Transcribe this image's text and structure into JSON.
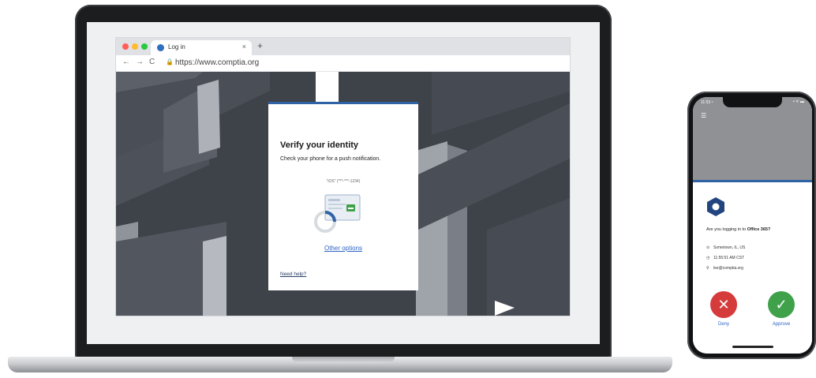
{
  "browser": {
    "tab_title": "Log in",
    "tab_close": "×",
    "new_tab": "+",
    "back": "←",
    "forward": "→",
    "reload": "C",
    "lock": "🔒",
    "url": "https://www.comptia.org"
  },
  "dialog": {
    "title": "Verify your identity",
    "subtitle": "Check your phone for a push notification.",
    "device": "\"iOS\" (***-***-1234)",
    "other_options": "Other options",
    "need_help": "Need help?"
  },
  "phone": {
    "status_time": "11:53 ⁴",
    "status_icons": "▪ ᯤ ▬",
    "menu_icon": "☰",
    "question_prefix": "Are you logging in to ",
    "question_app": "Office 365?",
    "location": "Sometown, IL, US",
    "time": "11:55:51 AM CST",
    "user": "lee@comptia.org",
    "deny_label": "Deny",
    "approve_label": "Approve",
    "deny_icon": "✕",
    "approve_icon": "✓"
  },
  "colors": {
    "accent": "#2f63a6",
    "deny": "#d63b3b",
    "approve": "#3fa14a",
    "page_bg": "#3e4249"
  }
}
